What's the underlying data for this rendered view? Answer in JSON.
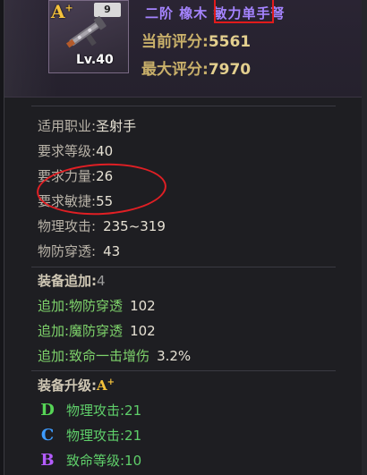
{
  "item": {
    "grade": "A",
    "grade_plus": "+",
    "count": "9",
    "level": "Lv.40",
    "name": "二阶 橡木 敏力单手弩",
    "current_score_label": "当前评分:",
    "current_score_value": "5561",
    "max_score_label": "最大评分:",
    "max_score_value": "7970",
    "icon": "crossbow-icon"
  },
  "requirements": [
    {
      "label": "适用职业:",
      "value": "圣射手"
    },
    {
      "label": "要求等级:",
      "value": "40"
    },
    {
      "label": "要求力量:",
      "value": "26"
    },
    {
      "label": "要求敏捷:",
      "value": "55"
    },
    {
      "label": "物理攻击:",
      "value": "235~319"
    },
    {
      "label": "物防穿透:",
      "value": "43"
    }
  ],
  "extras": {
    "title": "装备追加:",
    "count": "4",
    "items": [
      {
        "label": "追加:物防穿透",
        "value": "102"
      },
      {
        "label": "追加:魔防穿透",
        "value": "102"
      },
      {
        "label": "追加:致命一击增伤",
        "value": "3.2%"
      }
    ]
  },
  "upgrade": {
    "title": "装备升级:",
    "grade": "A",
    "grade_plus": "+",
    "items": [
      {
        "rank": "D",
        "rank_color": "#56d456",
        "text": "物理攻击:21"
      },
      {
        "rank": "C",
        "rank_color": "#3d9bff",
        "text": "物理攻击:21"
      },
      {
        "rank": "B",
        "rank_color": "#b45cff",
        "text": "致命等级:10"
      }
    ]
  },
  "colors": {
    "accent_gold": "#f5c23b",
    "name_purple": "#a584ff",
    "stat_green": "#7ed36b",
    "annotation_red": "#e01f24"
  }
}
